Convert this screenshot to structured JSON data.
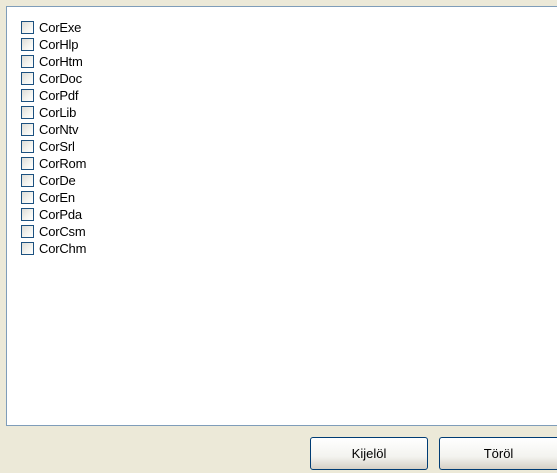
{
  "list": {
    "items": [
      {
        "label": "CorExe",
        "checked": false
      },
      {
        "label": "CorHlp",
        "checked": false
      },
      {
        "label": "CorHtm",
        "checked": false
      },
      {
        "label": "CorDoc",
        "checked": false
      },
      {
        "label": "CorPdf",
        "checked": false
      },
      {
        "label": "CorLib",
        "checked": false
      },
      {
        "label": "CorNtv",
        "checked": false
      },
      {
        "label": "CorSrl",
        "checked": false
      },
      {
        "label": "CorRom",
        "checked": false
      },
      {
        "label": "CorDe",
        "checked": false
      },
      {
        "label": "CorEn",
        "checked": false
      },
      {
        "label": "CorPda",
        "checked": false
      },
      {
        "label": "CorCsm",
        "checked": false
      },
      {
        "label": "CorChm",
        "checked": false
      }
    ]
  },
  "buttons": {
    "select_label": "Kijelöl",
    "delete_label": "Töröl"
  },
  "colors": {
    "background": "#ece9d8",
    "list_background": "#ffffff",
    "list_border": "#7f9db9",
    "button_border": "#003c74"
  }
}
